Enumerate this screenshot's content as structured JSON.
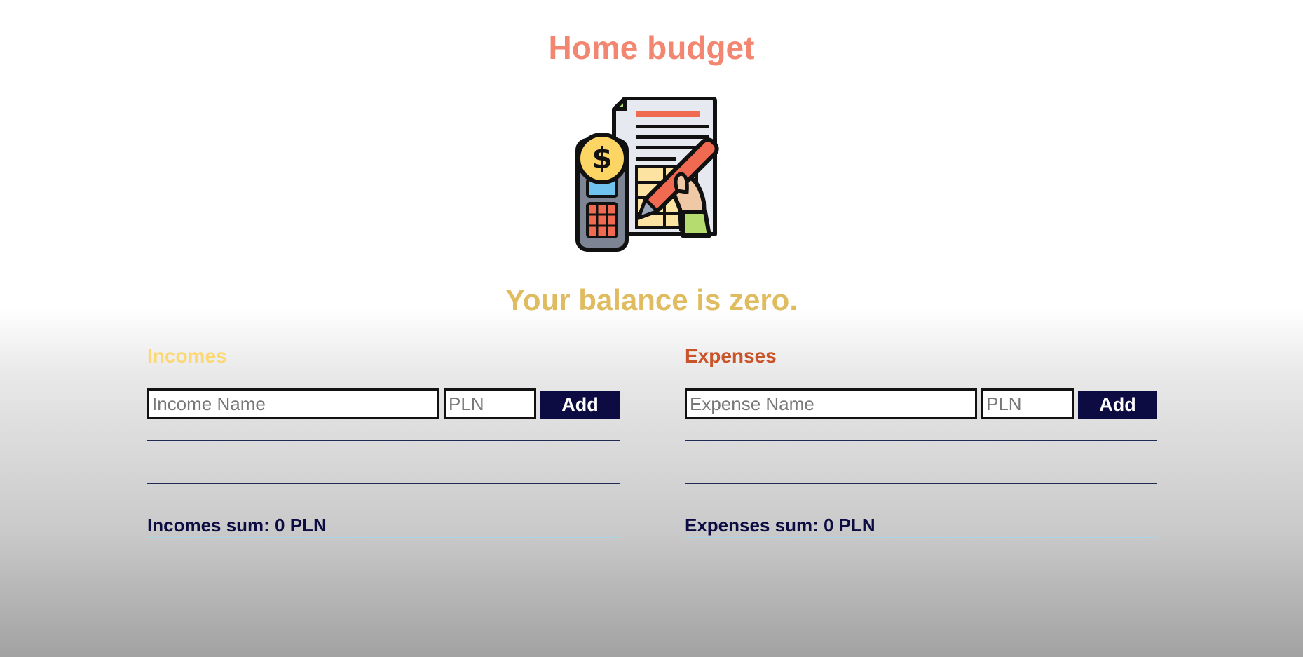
{
  "header": {
    "title": "Home budget",
    "logo_icon": "budget-calculator-icon"
  },
  "balance": {
    "text": "Your balance is zero."
  },
  "incomes": {
    "heading": "Incomes",
    "name_placeholder": "Income Name",
    "amount_placeholder": "PLN",
    "add_label": "Add",
    "sum_text": "Incomes sum: 0 PLN"
  },
  "expenses": {
    "heading": "Expenses",
    "name_placeholder": "Expense Name",
    "amount_placeholder": "PLN",
    "add_label": "Add",
    "sum_text": "Expenses sum: 0 PLN"
  },
  "colors": {
    "title": "#f28670",
    "balance": "#e0bc61",
    "incomes_heading": "#fcd874",
    "expenses_heading": "#c9542a",
    "button": "#0d0c42"
  }
}
